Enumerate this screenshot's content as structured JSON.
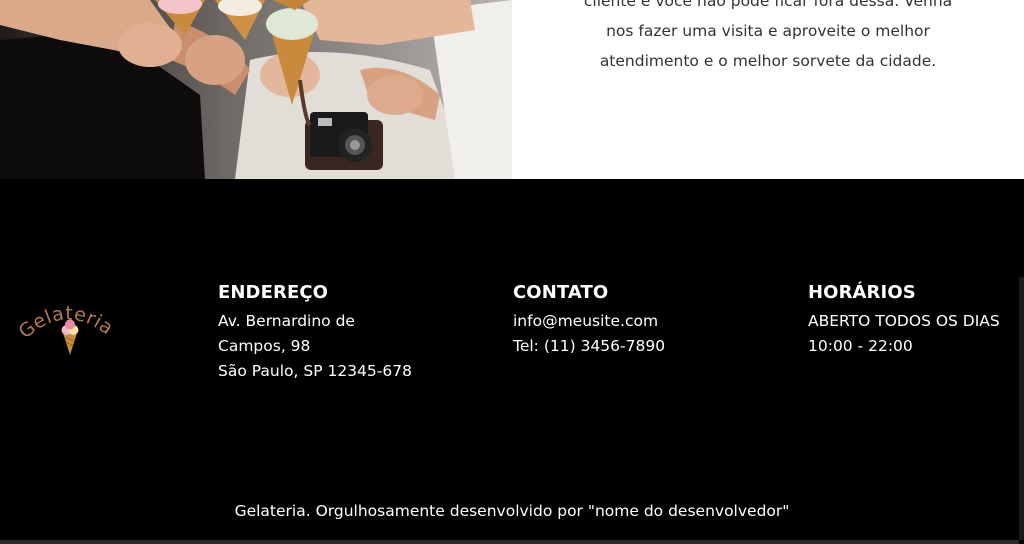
{
  "hero": {
    "lines": [
      "cliente e você não pode ficar fora dessa. Venha",
      "nos fazer uma visita e aproveite o melhor",
      "atendimento e o melhor sorvete da cidade."
    ]
  },
  "footer": {
    "logo_text": "Gelateria",
    "address": {
      "title": "ENDEREÇO",
      "lines": [
        "Av. Bernardino de",
        "Campos, 98",
        "São Paulo, SP 12345-678"
      ]
    },
    "contact": {
      "title": "CONTATO",
      "email": "info@meusite.com",
      "phone": "Tel: (11) 3456-7890"
    },
    "hours": {
      "title": "HORÁRIOS",
      "lines": [
        "ABERTO TODOS OS DIAS",
        "10:00 - 22:00"
      ]
    },
    "credit": "Gelateria. Orgulhosamente desenvolvido por \"nome do desenvolvedor\""
  },
  "colors": {
    "footer_bg": "#000000",
    "logo_text": "#b5784a",
    "hero_text": "#333333"
  }
}
